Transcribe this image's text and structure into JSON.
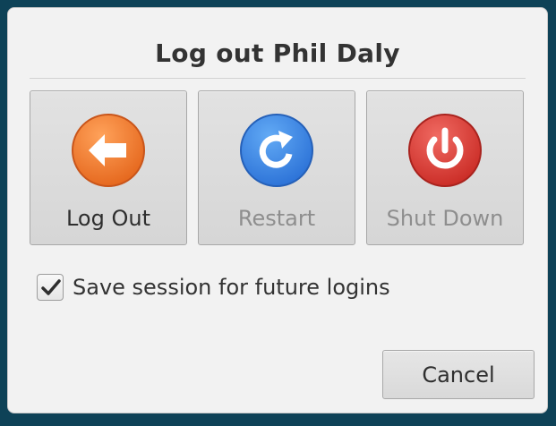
{
  "dialog": {
    "title": "Log out Phil Daly"
  },
  "actions": [
    {
      "label": "Log Out",
      "icon": "arrow-left-icon",
      "color": "#f07a2a",
      "enabled": true
    },
    {
      "label": "Restart",
      "icon": "restart-icon",
      "color": "#3584e4",
      "enabled": false
    },
    {
      "label": "Shut Down",
      "icon": "power-icon",
      "color": "#d63a33",
      "enabled": false
    }
  ],
  "save_session": {
    "label": "Save session for future logins",
    "checked": true
  },
  "cancel": {
    "label": "Cancel"
  }
}
